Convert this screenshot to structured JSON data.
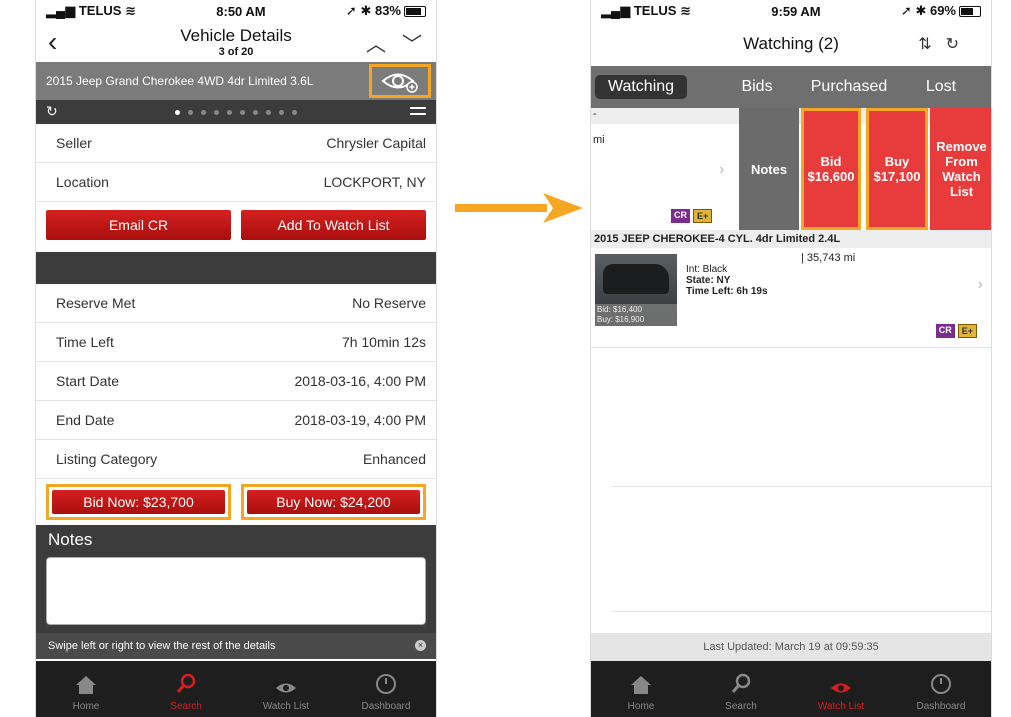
{
  "left": {
    "status": {
      "carrier": "TELUS",
      "time": "8:50 AM",
      "battery": "83%"
    },
    "nav": {
      "title": "Vehicle Details",
      "subtitle": "3 of 20"
    },
    "vehicle_name": "2015 Jeep Grand Cherokee 4WD 4dr Limited 3.6L",
    "details_top": [
      {
        "label": "Seller",
        "value": "Chrysler Capital"
      },
      {
        "label": "Location",
        "value": "LOCKPORT, NY"
      }
    ],
    "email_cr": "Email CR",
    "add_watch": "Add To Watch List",
    "details_bottom": [
      {
        "label": "Reserve Met",
        "value": "No Reserve"
      },
      {
        "label": "Time Left",
        "value": "7h 10min 12s"
      },
      {
        "label": "Start Date",
        "value": "2018-03-16, 4:00 PM"
      },
      {
        "label": "End Date",
        "value": "2018-03-19, 4:00 PM"
      },
      {
        "label": "Listing Category",
        "value": "Enhanced"
      }
    ],
    "bid_now": "Bid Now: $23,700",
    "buy_now": "Buy Now: $24,200",
    "notes_title": "Notes",
    "swipe_hint": "Swipe left or right to view the rest of the details",
    "tabs": [
      "Home",
      "Search",
      "Watch List",
      "Dashboard"
    ]
  },
  "right": {
    "status": {
      "carrier": "TELUS",
      "time": "9:59 AM",
      "battery": "69%"
    },
    "nav_title": "Watching (2)",
    "segments": [
      "Watching",
      "Bids",
      "Purchased",
      "Lost"
    ],
    "partial_row": {
      "dash": "-",
      "mi": "mi"
    },
    "actions": {
      "notes": "Notes",
      "bid_label": "Bid",
      "bid_value": "$16,600",
      "buy_label": "Buy",
      "buy_value": "$17,100",
      "remove": "Remove From Watch List"
    },
    "badges": {
      "cr": "CR",
      "ep": "E+"
    },
    "listing": {
      "title": "2015 JEEP CHEROKEE-4 CYL. 4dr Limited 2.4L",
      "miles": "| 35,743 mi",
      "int": "Int: Black",
      "state": "State: NY",
      "time_left": "Time Left: 6h 19s",
      "bid": "Bid: $16,400",
      "buy": "Buy: $16,900"
    },
    "last_updated": "Last Updated: March 19 at 09:59:35",
    "tabs": [
      "Home",
      "Search",
      "Watch List",
      "Dashboard"
    ]
  },
  "colors": {
    "accent_red": "#d41f1f",
    "highlight": "#f5a623",
    "arrow": "#f5a623"
  }
}
